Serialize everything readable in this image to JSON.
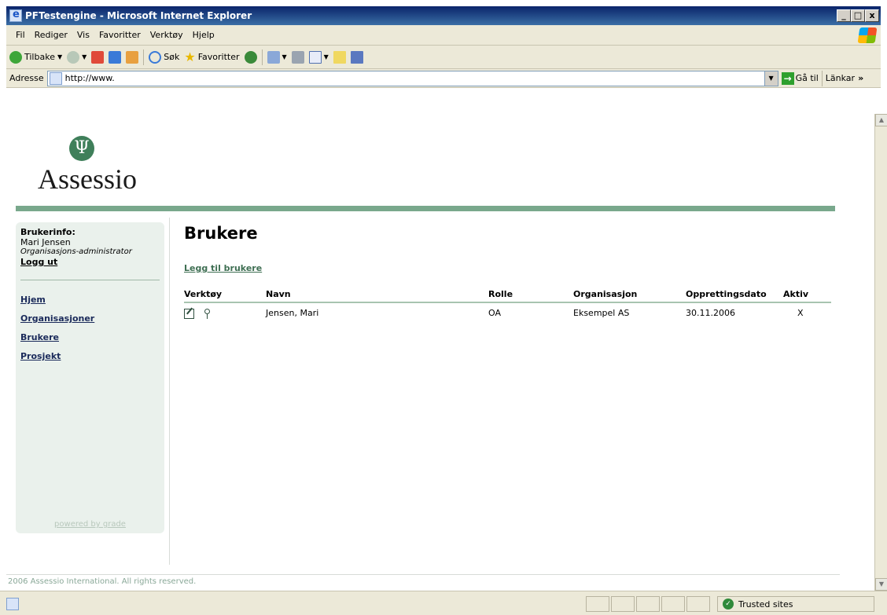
{
  "window": {
    "title": "PFTestengine - Microsoft Internet Explorer",
    "min": "_",
    "max": "□",
    "close": "x"
  },
  "menu": [
    "Fil",
    "Rediger",
    "Vis",
    "Favoritter",
    "Verktøy",
    "Hjelp"
  ],
  "toolbar": {
    "back": "Tilbake",
    "search": "Søk",
    "favorites": "Favoritter"
  },
  "address": {
    "label": "Adresse",
    "url": "http://www.",
    "go": "Gå til",
    "links": "Länkar",
    "more": "»"
  },
  "page": {
    "logo_text": "Assessio",
    "logo_symbol": "Ψ",
    "sidebar": {
      "heading": "Brukerinfo:",
      "user_name": "Mari Jensen",
      "user_role": "Organisasjons-administrator",
      "logout": "Logg ut",
      "nav": [
        "Hjem",
        "Organisasjoner",
        "Brukere",
        "Prosjekt"
      ],
      "powered": "powered by grade"
    },
    "title": "Brukere",
    "add_user": "Legg til brukere",
    "table": {
      "headers": [
        "Verktøy",
        "Navn",
        "Rolle",
        "Organisasjon",
        "Opprettingsdato",
        "Aktiv"
      ],
      "rows": [
        {
          "name": "Jensen, Mari",
          "role": "OA",
          "organization": "Eksempel AS",
          "created": "30.11.2006",
          "active": "X"
        }
      ]
    },
    "footer": "2006 Assessio International. All rights reserved."
  },
  "status": {
    "zone": "Trusted sites"
  },
  "colors": {
    "accent_green": "#79a88c",
    "sidebar_bg": "#eaf1ec",
    "titlebar": "#0a246a"
  }
}
